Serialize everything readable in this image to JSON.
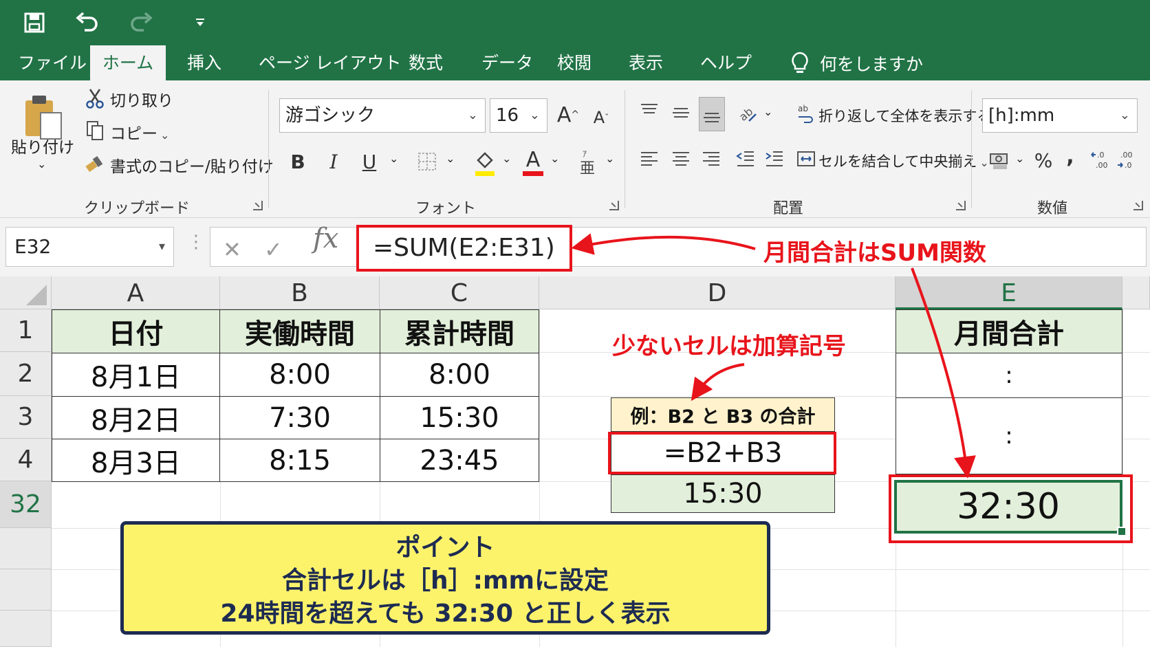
{
  "quick_access": {
    "save_icon": "save-icon",
    "undo_icon": "undo-icon",
    "redo_icon": "redo-icon",
    "customize_icon": "customize-qat-icon"
  },
  "tabs": [
    "ファイル",
    "ホーム",
    "挿入",
    "ページ レイアウト",
    "数式",
    "データ",
    "校閲",
    "表示",
    "ヘルプ"
  ],
  "active_tab": "ホーム",
  "tell_me": "何をしますか",
  "ribbon": {
    "clipboard": {
      "paste": "貼り付け",
      "cut": "切り取り",
      "copy": "コピー",
      "format_painter": "書式のコピー/貼り付け",
      "label": "クリップボード"
    },
    "font": {
      "family": "游ゴシック",
      "size": "16",
      "label": "フォント",
      "bold": "B",
      "italic": "I",
      "underline": "U",
      "grow": "A",
      "shrink": "A",
      "font_color_glyph": "A"
    },
    "alignment": {
      "wrap_text": "折り返して全体を表示する",
      "merge_center": "セルを結合して中央揃え",
      "label": "配置"
    },
    "number": {
      "format": "[h]:mm",
      "percent": "%",
      "comma": "，",
      "inc_decimal": "←.0\n.00",
      "dec_decimal": ".00\n→.0",
      "label": "数値"
    }
  },
  "formula_bar": {
    "name_box": "E32",
    "cancel": "✕",
    "enter": "✓",
    "fx": "fx",
    "formula": "=SUM(E2:E31)"
  },
  "columns": [
    "A",
    "B",
    "C",
    "D",
    "E"
  ],
  "selected_column": "E",
  "rows": [
    "1",
    "2",
    "3",
    "4",
    "32"
  ],
  "selected_row": "32",
  "table": {
    "headers": [
      "日付",
      "実働時間",
      "累計時間"
    ],
    "rows": [
      [
        "8月1日",
        "8:00",
        "8:00"
      ],
      [
        "8月2日",
        "7:30",
        "15:30"
      ],
      [
        "8月3日",
        "8:15",
        "23:45"
      ]
    ]
  },
  "e_column": {
    "header": "月間合計",
    "ellipsis_1": ":",
    "ellipsis_2": ":",
    "total": "32:30"
  },
  "example": {
    "title": "例：B2 と B3 の合計",
    "formula": "=B2+B3",
    "result": "15:30"
  },
  "annotations": {
    "sum_callout": "月間合計はSUM関数",
    "few_cells_callout": "少ないセルは加算記号"
  },
  "point_box": {
    "title": "ポイント",
    "line1": "合計セルは［h］:mmに設定",
    "line2": "24時間を超えても 32:30 と正しく表示"
  },
  "colors": {
    "excel_green": "#217346",
    "header_fill": "#e2efda",
    "callout_red": "#e8141b",
    "point_fill": "#fdf36b",
    "point_border": "#1d2b52"
  }
}
